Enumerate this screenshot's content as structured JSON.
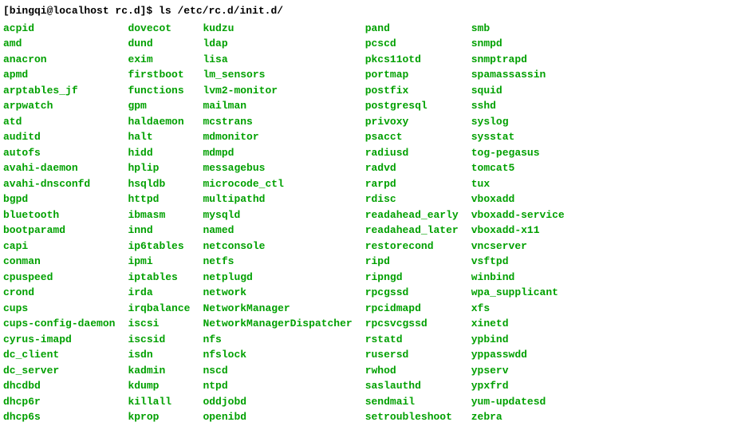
{
  "prompt": {
    "user_host": "[bingqi@localhost rc.d]$ ",
    "command": "ls /etc/rc.d/init.d/"
  },
  "columns": [
    [
      "acpid",
      "amd",
      "anacron",
      "apmd",
      "arptables_jf",
      "arpwatch",
      "atd",
      "auditd",
      "autofs",
      "avahi-daemon",
      "avahi-dnsconfd",
      "bgpd",
      "bluetooth",
      "bootparamd",
      "capi",
      "conman",
      "cpuspeed",
      "crond",
      "cups",
      "cups-config-daemon",
      "cyrus-imapd",
      "dc_client",
      "dc_server",
      "dhcdbd",
      "dhcp6r",
      "dhcp6s"
    ],
    [
      "dovecot",
      "dund",
      "exim",
      "firstboot",
      "functions",
      "gpm",
      "haldaemon",
      "halt",
      "hidd",
      "hplip",
      "hsqldb",
      "httpd",
      "ibmasm",
      "innd",
      "ip6tables",
      "ipmi",
      "iptables",
      "irda",
      "irqbalance",
      "iscsi",
      "iscsid",
      "isdn",
      "kadmin",
      "kdump",
      "killall",
      "kprop"
    ],
    [
      "kudzu",
      "ldap",
      "lisa",
      "lm_sensors",
      "lvm2-monitor",
      "mailman",
      "mcstrans",
      "mdmonitor",
      "mdmpd",
      "messagebus",
      "microcode_ctl",
      "multipathd",
      "mysqld",
      "named",
      "netconsole",
      "netfs",
      "netplugd",
      "network",
      "NetworkManager",
      "NetworkManagerDispatcher",
      "nfs",
      "nfslock",
      "nscd",
      "ntpd",
      "oddjobd",
      "openibd"
    ],
    [
      "pand",
      "pcscd",
      "pkcs11otd",
      "portmap",
      "postfix",
      "postgresql",
      "privoxy",
      "psacct",
      "radiusd",
      "radvd",
      "rarpd",
      "rdisc",
      "readahead_early",
      "readahead_later",
      "restorecond",
      "ripd",
      "ripngd",
      "rpcgssd",
      "rpcidmapd",
      "rpcsvcgssd",
      "rstatd",
      "rusersd",
      "rwhod",
      "saslauthd",
      "sendmail",
      "setroubleshoot"
    ],
    [
      "smb",
      "snmpd",
      "snmptrapd",
      "spamassassin",
      "squid",
      "sshd",
      "syslog",
      "sysstat",
      "tog-pegasus",
      "tomcat5",
      "tux",
      "vboxadd",
      "vboxadd-service",
      "vboxadd-x11",
      "vncserver",
      "vsftpd",
      "winbind",
      "wpa_supplicant",
      "xfs",
      "xinetd",
      "ypbind",
      "yppasswdd",
      "ypserv",
      "ypxfrd",
      "yum-updatesd",
      "zebra"
    ]
  ]
}
